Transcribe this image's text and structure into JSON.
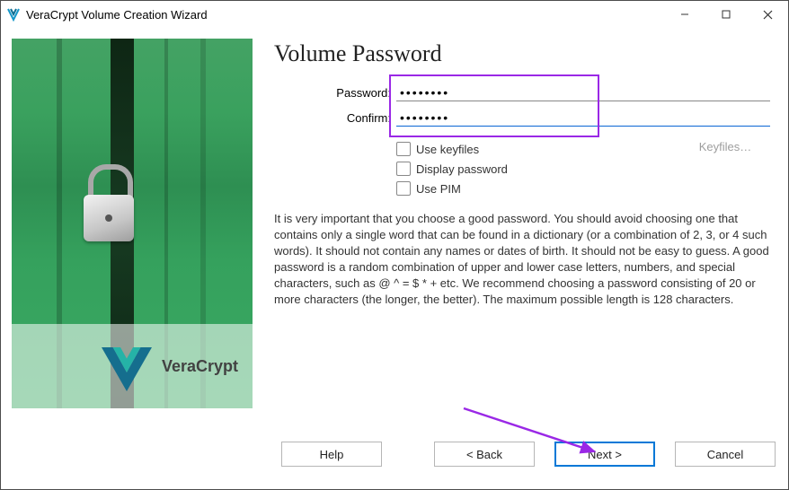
{
  "window": {
    "title": "VeraCrypt Volume Creation Wizard"
  },
  "page": {
    "heading": "Volume Password"
  },
  "fields": {
    "password_label": "Password:",
    "password_value": "••••••••",
    "confirm_label": "Confirm:",
    "confirm_value": "••••••••"
  },
  "checks": {
    "use_keyfiles": "Use keyfiles",
    "display_password": "Display password",
    "use_pim": "Use PIM"
  },
  "keyfiles_button": "Keyfiles…",
  "info_text": "It is very important that you choose a good password. You should avoid choosing one that contains only a single word that can be found in a dictionary (or a combination of 2, 3, or 4 such words). It should not contain any names or dates of birth. It should not be easy to guess. A good password is a random combination of upper and lower case letters, numbers, and special characters, such as @ ^ = $ * + etc. We recommend choosing a password consisting of 20 or more characters (the longer, the better). The maximum possible length is 128 characters.",
  "sidebar": {
    "product_name": "VeraCrypt"
  },
  "footer": {
    "help": "Help",
    "back": "<  Back",
    "next": "Next  >",
    "cancel": "Cancel"
  }
}
